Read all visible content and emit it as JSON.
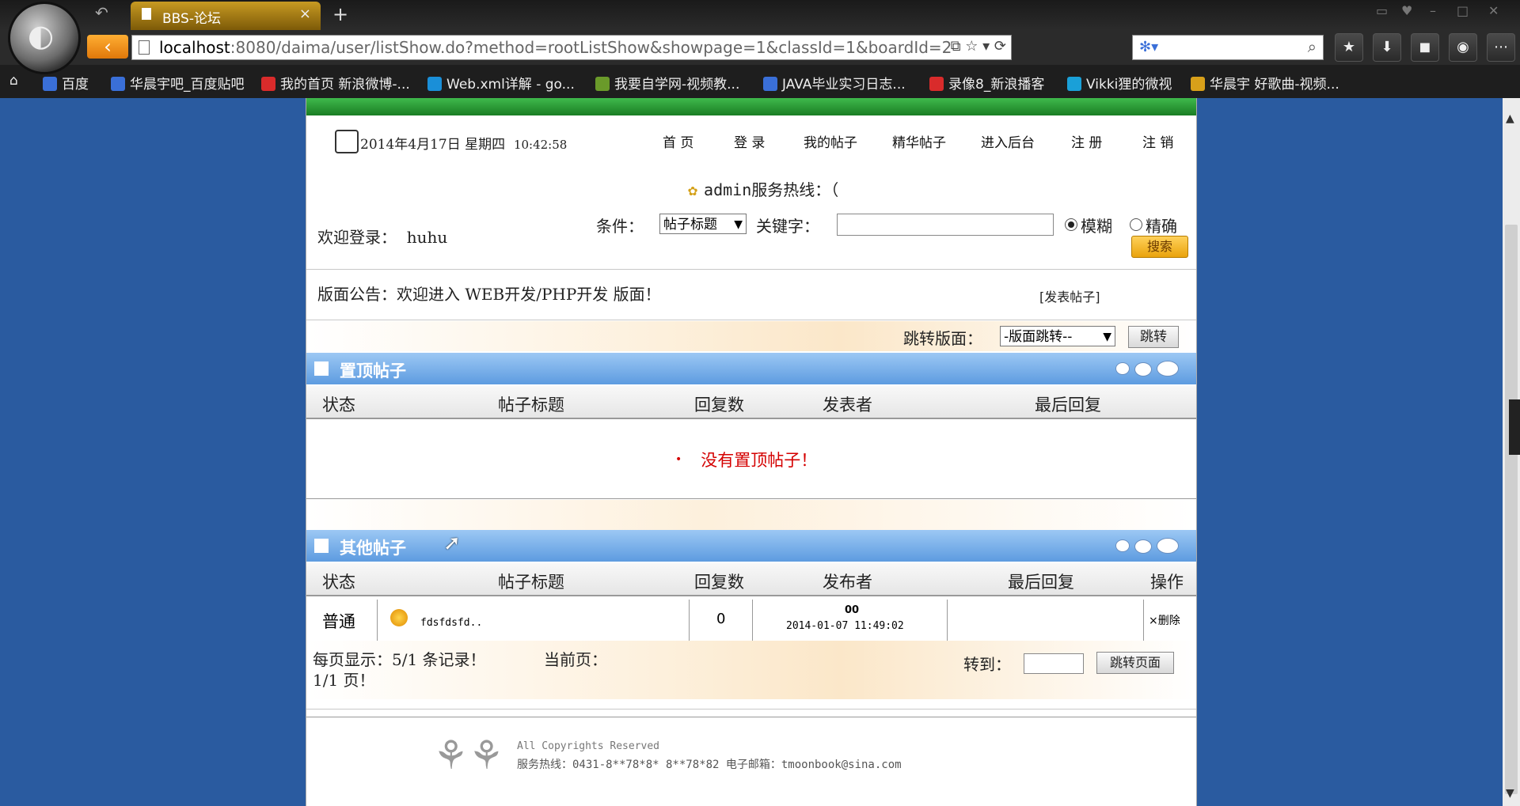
{
  "browser": {
    "tab_title": "BBS-论坛",
    "tab_close": "×",
    "new_tab": "+",
    "url_host": "localhost",
    "url_rest": ":8080/daima/user/listShow.do?method=rootListShow&showpage=1&classId=1&boardId=2",
    "bookmarks": [
      "百度",
      "华晨宇吧_百度贴吧",
      "我的首页 新浪微博-...",
      "Web.xml详解 - go...",
      "我要自学网-视频教...",
      "JAVA毕业实习日志...",
      "录像8_新浪播客",
      "Vikki狸的微视",
      "华晨宇 好歌曲-视频..."
    ],
    "bookmark_colors": [
      "#3a6fd8",
      "#3a6fd8",
      "#d92b2b",
      "#1a8fd8",
      "#6a9a2a",
      "#3a6fd8",
      "#d92b2b",
      "#1aa0d8",
      "#d8a01a"
    ]
  },
  "header": {
    "date": "2014年4月17日 星期四",
    "time": "10:42:58",
    "nav": [
      "首 页",
      "登 录",
      "我的帖子",
      "精华帖子",
      "进入后台",
      "注 册",
      "注 销"
    ],
    "hotline": "admin服务热线：（"
  },
  "search": {
    "welcome_label": "欢迎登录：",
    "username": "huhu",
    "condition_label": "条件：",
    "condition_value": "帖子标题",
    "keyword_label": "关键字：",
    "keyword_value": "",
    "fuzzy_label": "模糊",
    "exact_label": "精确",
    "button_label": "搜索"
  },
  "board": {
    "notice": "版面公告：欢迎进入 WEB开发/PHP开发 版面！",
    "post_link": "[发表帖子]",
    "jump_label": "跳转版面：",
    "jump_select": "-版面跳转--",
    "jump_button": "跳转"
  },
  "top_posts": {
    "title": "置顶帖子",
    "columns": [
      "状态",
      "帖子标题",
      "回复数",
      "发表者",
      "最后回复"
    ],
    "empty_bullet": "•",
    "empty_message": "没有置顶帖子！"
  },
  "other_posts": {
    "title": "其他帖子",
    "columns": [
      "状态",
      "帖子标题",
      "回复数",
      "发布者",
      "最后回复",
      "操作"
    ],
    "rows": [
      {
        "status": "普通",
        "title": "fdsfdsfd..",
        "replies": "0",
        "author": "00",
        "date": "2014-01-07 11:49:02",
        "last_reply": "",
        "action": "×删除"
      }
    ]
  },
  "pager": {
    "line1": "每页显示：5/1 条记录！",
    "current": "当前页：",
    "line2": "1/1 页！",
    "goto_label": "转到：",
    "goto_button": "跳转页面"
  },
  "footer": {
    "copyright": "All Copyrights  Reserved",
    "contact": "服务热线：0431-8**78*8*  8**78*82   电子邮箱：tmoonbook@sina.com"
  },
  "colors": {
    "accent_green": "#2a9a35",
    "section_blue": "#5d9be0",
    "empty_red": "#d40000",
    "background": "#2a5ba0"
  }
}
